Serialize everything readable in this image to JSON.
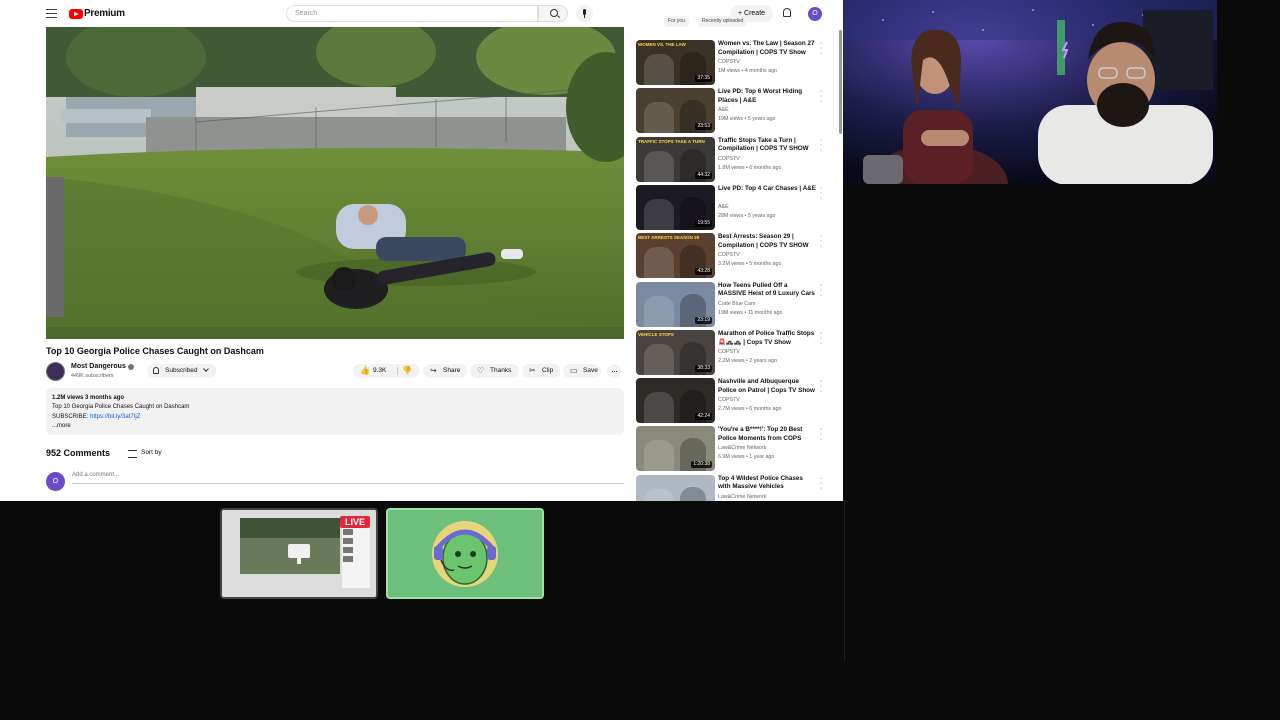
{
  "youtube": {
    "brand": "Premium",
    "search_placeholder": "Search",
    "create_label": "Create",
    "avatar_letter": "O",
    "video": {
      "title": "Top 10 Georgia Police Chases Caught on Dashcam",
      "channel": "Most Dangerous",
      "subscribers": "449K subscribers",
      "subscribe_label": "Subscribed",
      "likes": "9.3K",
      "share_label": "Share",
      "thanks_label": "Thanks",
      "clip_label": "Clip",
      "save_label": "Save"
    },
    "description": {
      "stats": "1.2M views  3 months ago",
      "line1": "Top 10 Georgia Police Chases Caught on Dashcam",
      "subscribe_prefix": "SUBSCRIBE: ",
      "link": "https://bit.ly/3at7IjZ",
      "more": "...more"
    },
    "comments": {
      "count_label": "952 Comments",
      "sort_label": "Sort by",
      "add_placeholder": "Add a comment..."
    },
    "chips": [
      "For you",
      "Recently uploaded"
    ],
    "sidebar": [
      {
        "title": "Women vs. The Law | Season 27 Compilation | COPS TV Show",
        "channel": "COPSTV",
        "meta": "1M views • 4 months ago",
        "duration": "37:35",
        "thumb_text": "WOMEN VS. THE LAW",
        "thumb_color": "#3a3226"
      },
      {
        "title": "Live PD: Top 6 Worst Hiding Places | A&E",
        "channel": "A&E",
        "meta": "19M views • 5 years ago",
        "duration": "23:53",
        "thumb_text": "",
        "thumb_color": "#4a4030"
      },
      {
        "title": "Traffic Stops Take a Turn | Compilation | COPS TV SHOW",
        "channel": "COPSTV",
        "meta": "1.8M views • 6 months ago",
        "duration": "44:32",
        "thumb_text": "TRAFFIC STOPS TAKE A TURN",
        "thumb_color": "#3c3a36"
      },
      {
        "title": "Live PD: Top 4 Car Chases | A&E",
        "channel": "A&E",
        "meta": "28M views • 5 years ago",
        "duration": "19:55",
        "thumb_text": "",
        "thumb_color": "#1c1a22"
      },
      {
        "title": "Best Arrests: Season 29 | Compilation | COPS TV SHOW",
        "channel": "COPSTV",
        "meta": "3.2M views • 5 months ago",
        "duration": "43:28",
        "thumb_text": "BEST ARRESTS SEASON 29",
        "thumb_color": "#5a4030"
      },
      {
        "title": "How Teens Pulled Off a MASSIVE Heist of 9 Luxury Cars",
        "channel": "Code Blue Cam",
        "meta": "19M views • 11 months ago",
        "duration": "23:19",
        "thumb_text": "",
        "thumb_color": "#7a8aa0"
      },
      {
        "title": "Marathon of Police Traffic Stops 🚨🚓🚓 | Cops TV Show",
        "channel": "COPSTV",
        "meta": "2.2M views • 2 years ago",
        "duration": "38:33",
        "thumb_text": "VEHICLE STOPS",
        "thumb_color": "#4a4440"
      },
      {
        "title": "Nashville and Albuquerque Police on Patrol | Cops TV Show",
        "channel": "COPSTV",
        "meta": "2.7M views • 6 months ago",
        "duration": "42:24",
        "thumb_text": "",
        "thumb_color": "#2e2a26"
      },
      {
        "title": "'You're a B****!': Top 20 Best Police Moments from COPS",
        "channel": "Law&Crime Network",
        "meta": "6.9M views • 1 year ago",
        "duration": "1:20:38",
        "thumb_text": "",
        "thumb_color": "#8a8a7a"
      },
      {
        "title": "Top 4 Wildest Police Chases with Massive Vehicles",
        "channel": "Law&Crime Network",
        "meta": "",
        "duration": "",
        "thumb_text": "",
        "thumb_color": "#b0b8c4"
      }
    ]
  },
  "scenes": {
    "live_label": "LIVE"
  }
}
